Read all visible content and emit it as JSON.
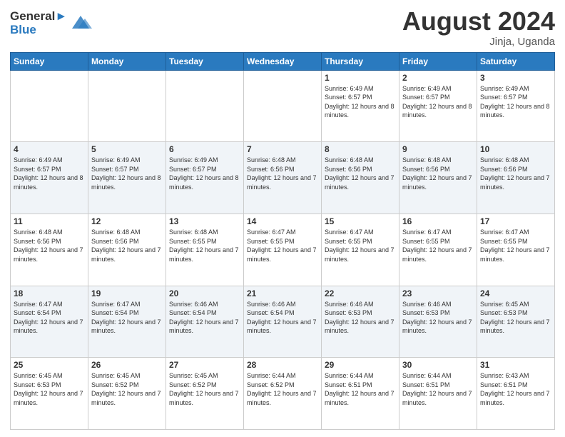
{
  "header": {
    "logo_general": "General",
    "logo_blue": "Blue",
    "month_title": "August 2024",
    "location": "Jinja, Uganda"
  },
  "days_of_week": [
    "Sunday",
    "Monday",
    "Tuesday",
    "Wednesday",
    "Thursday",
    "Friday",
    "Saturday"
  ],
  "weeks": [
    [
      {
        "day": "",
        "sunrise": "",
        "sunset": "",
        "daylight": ""
      },
      {
        "day": "",
        "sunrise": "",
        "sunset": "",
        "daylight": ""
      },
      {
        "day": "",
        "sunrise": "",
        "sunset": "",
        "daylight": ""
      },
      {
        "day": "",
        "sunrise": "",
        "sunset": "",
        "daylight": ""
      },
      {
        "day": "1",
        "sunrise": "Sunrise: 6:49 AM",
        "sunset": "Sunset: 6:57 PM",
        "daylight": "Daylight: 12 hours and 8 minutes."
      },
      {
        "day": "2",
        "sunrise": "Sunrise: 6:49 AM",
        "sunset": "Sunset: 6:57 PM",
        "daylight": "Daylight: 12 hours and 8 minutes."
      },
      {
        "day": "3",
        "sunrise": "Sunrise: 6:49 AM",
        "sunset": "Sunset: 6:57 PM",
        "daylight": "Daylight: 12 hours and 8 minutes."
      }
    ],
    [
      {
        "day": "4",
        "sunrise": "Sunrise: 6:49 AM",
        "sunset": "Sunset: 6:57 PM",
        "daylight": "Daylight: 12 hours and 8 minutes."
      },
      {
        "day": "5",
        "sunrise": "Sunrise: 6:49 AM",
        "sunset": "Sunset: 6:57 PM",
        "daylight": "Daylight: 12 hours and 8 minutes."
      },
      {
        "day": "6",
        "sunrise": "Sunrise: 6:49 AM",
        "sunset": "Sunset: 6:57 PM",
        "daylight": "Daylight: 12 hours and 8 minutes."
      },
      {
        "day": "7",
        "sunrise": "Sunrise: 6:48 AM",
        "sunset": "Sunset: 6:56 PM",
        "daylight": "Daylight: 12 hours and 7 minutes."
      },
      {
        "day": "8",
        "sunrise": "Sunrise: 6:48 AM",
        "sunset": "Sunset: 6:56 PM",
        "daylight": "Daylight: 12 hours and 7 minutes."
      },
      {
        "day": "9",
        "sunrise": "Sunrise: 6:48 AM",
        "sunset": "Sunset: 6:56 PM",
        "daylight": "Daylight: 12 hours and 7 minutes."
      },
      {
        "day": "10",
        "sunrise": "Sunrise: 6:48 AM",
        "sunset": "Sunset: 6:56 PM",
        "daylight": "Daylight: 12 hours and 7 minutes."
      }
    ],
    [
      {
        "day": "11",
        "sunrise": "Sunrise: 6:48 AM",
        "sunset": "Sunset: 6:56 PM",
        "daylight": "Daylight: 12 hours and 7 minutes."
      },
      {
        "day": "12",
        "sunrise": "Sunrise: 6:48 AM",
        "sunset": "Sunset: 6:56 PM",
        "daylight": "Daylight: 12 hours and 7 minutes."
      },
      {
        "day": "13",
        "sunrise": "Sunrise: 6:48 AM",
        "sunset": "Sunset: 6:55 PM",
        "daylight": "Daylight: 12 hours and 7 minutes."
      },
      {
        "day": "14",
        "sunrise": "Sunrise: 6:47 AM",
        "sunset": "Sunset: 6:55 PM",
        "daylight": "Daylight: 12 hours and 7 minutes."
      },
      {
        "day": "15",
        "sunrise": "Sunrise: 6:47 AM",
        "sunset": "Sunset: 6:55 PM",
        "daylight": "Daylight: 12 hours and 7 minutes."
      },
      {
        "day": "16",
        "sunrise": "Sunrise: 6:47 AM",
        "sunset": "Sunset: 6:55 PM",
        "daylight": "Daylight: 12 hours and 7 minutes."
      },
      {
        "day": "17",
        "sunrise": "Sunrise: 6:47 AM",
        "sunset": "Sunset: 6:55 PM",
        "daylight": "Daylight: 12 hours and 7 minutes."
      }
    ],
    [
      {
        "day": "18",
        "sunrise": "Sunrise: 6:47 AM",
        "sunset": "Sunset: 6:54 PM",
        "daylight": "Daylight: 12 hours and 7 minutes."
      },
      {
        "day": "19",
        "sunrise": "Sunrise: 6:47 AM",
        "sunset": "Sunset: 6:54 PM",
        "daylight": "Daylight: 12 hours and 7 minutes."
      },
      {
        "day": "20",
        "sunrise": "Sunrise: 6:46 AM",
        "sunset": "Sunset: 6:54 PM",
        "daylight": "Daylight: 12 hours and 7 minutes."
      },
      {
        "day": "21",
        "sunrise": "Sunrise: 6:46 AM",
        "sunset": "Sunset: 6:54 PM",
        "daylight": "Daylight: 12 hours and 7 minutes."
      },
      {
        "day": "22",
        "sunrise": "Sunrise: 6:46 AM",
        "sunset": "Sunset: 6:53 PM",
        "daylight": "Daylight: 12 hours and 7 minutes."
      },
      {
        "day": "23",
        "sunrise": "Sunrise: 6:46 AM",
        "sunset": "Sunset: 6:53 PM",
        "daylight": "Daylight: 12 hours and 7 minutes."
      },
      {
        "day": "24",
        "sunrise": "Sunrise: 6:45 AM",
        "sunset": "Sunset: 6:53 PM",
        "daylight": "Daylight: 12 hours and 7 minutes."
      }
    ],
    [
      {
        "day": "25",
        "sunrise": "Sunrise: 6:45 AM",
        "sunset": "Sunset: 6:53 PM",
        "daylight": "Daylight: 12 hours and 7 minutes."
      },
      {
        "day": "26",
        "sunrise": "Sunrise: 6:45 AM",
        "sunset": "Sunset: 6:52 PM",
        "daylight": "Daylight: 12 hours and 7 minutes."
      },
      {
        "day": "27",
        "sunrise": "Sunrise: 6:45 AM",
        "sunset": "Sunset: 6:52 PM",
        "daylight": "Daylight: 12 hours and 7 minutes."
      },
      {
        "day": "28",
        "sunrise": "Sunrise: 6:44 AM",
        "sunset": "Sunset: 6:52 PM",
        "daylight": "Daylight: 12 hours and 7 minutes."
      },
      {
        "day": "29",
        "sunrise": "Sunrise: 6:44 AM",
        "sunset": "Sunset: 6:51 PM",
        "daylight": "Daylight: 12 hours and 7 minutes."
      },
      {
        "day": "30",
        "sunrise": "Sunrise: 6:44 AM",
        "sunset": "Sunset: 6:51 PM",
        "daylight": "Daylight: 12 hours and 7 minutes."
      },
      {
        "day": "31",
        "sunrise": "Sunrise: 6:43 AM",
        "sunset": "Sunset: 6:51 PM",
        "daylight": "Daylight: 12 hours and 7 minutes."
      }
    ]
  ]
}
